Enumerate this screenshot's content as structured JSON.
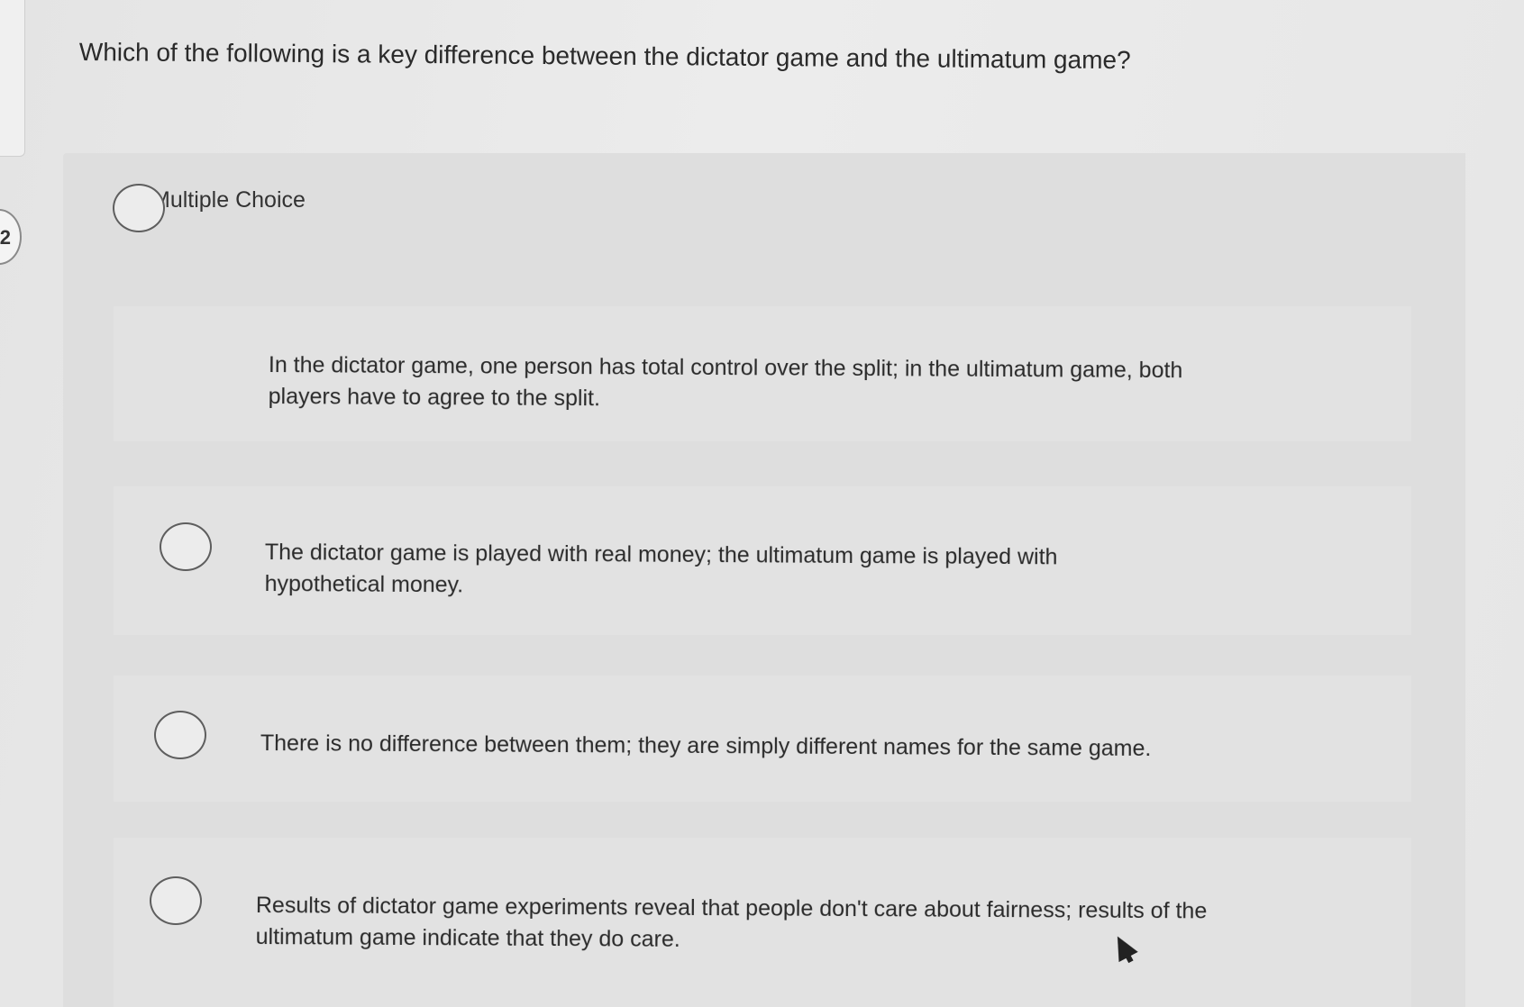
{
  "question": {
    "number": "2",
    "text": "Which of the following is a key difference between the dictator game and the ultimatum game?"
  },
  "section_label": "Multiple Choice",
  "options": [
    {
      "text": "In the dictator game, one person has total control over the split; in the ultimatum game, both players have to agree to the split."
    },
    {
      "text": "The dictator game is played with real money; the ultimatum game is played with hypothetical money."
    },
    {
      "text": "There is no difference between them; they are simply different names for the same game."
    },
    {
      "text": "Results of dictator game experiments reveal that people don't care about fairness; results of the ultimatum game indicate that they do care."
    }
  ],
  "icons": {
    "radio": "radio-circle-icon",
    "cursor": "mouse-pointer-icon"
  }
}
